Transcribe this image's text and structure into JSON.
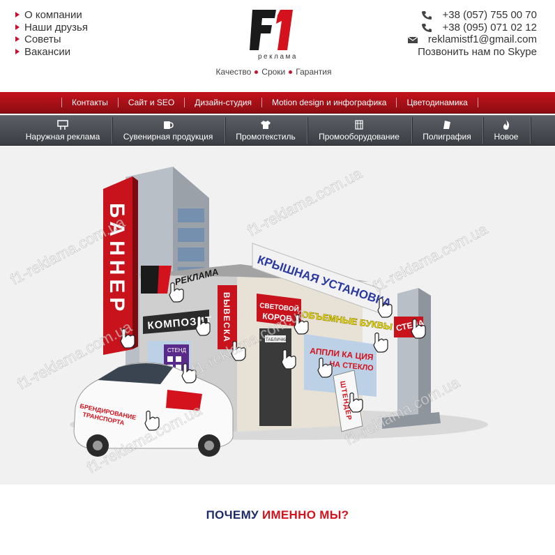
{
  "header": {
    "left_links": [
      "О компании",
      "Наши друзья",
      "Советы",
      "Вакансии"
    ],
    "logo_text": "реклама",
    "tagline": [
      "Качество",
      "Сроки",
      "Гарантия"
    ],
    "phones": [
      "+38 (057) 755 00 70",
      "+38 (095) 071 02 12"
    ],
    "email": "reklamistf1@gmail.com",
    "skype": "Позвонить нам по Skype"
  },
  "nav_red": [
    "Контакты",
    "Сайт и SEO",
    "Дизайн-студия",
    "Motion design и инфографика",
    "Цветодинамика"
  ],
  "nav_dark": [
    {
      "label": "Наружная реклама",
      "icon": "billboard-icon"
    },
    {
      "label": "Сувенирная продукция",
      "icon": "mug-icon"
    },
    {
      "label": "Промотекстиль",
      "icon": "tshirt-icon"
    },
    {
      "label": "Промооборудование",
      "icon": "stand-icon"
    },
    {
      "label": "Полиграфия",
      "icon": "paper-icon"
    },
    {
      "label": "Новое",
      "icon": "fire-icon"
    }
  ],
  "hero": {
    "banner": "БАННЕР",
    "brand": "РЕКЛАМА",
    "roof_sign": "КРЫШНАЯ УСТАНОВКА",
    "composite": "КОМПОЗИТ",
    "vyveska": "ВЫВЕСКА",
    "lightbox": [
      "СВЕТОВОЙ",
      "КОРОБ"
    ],
    "letters": "ОБЪЕМНЫЕ БУКВЫ",
    "application": [
      "АППЛИ КА ЦИЯ",
      "НА СТЕКЛО"
    ],
    "stand": "СТЕНД",
    "plate": "ТАБЛИЧКИ",
    "stela": "СТЕЛА",
    "shtender": "ШТЕНДЕР",
    "car": [
      "БРЕНДИРОВАНИЕ",
      "ТРАНСПОРТА"
    ],
    "watermark": "f1-reklama.com.ua"
  },
  "why": {
    "part1": "ПОЧЕМУ",
    "part2": "ИМЕННО МЫ?"
  },
  "colors": {
    "accent_red": "#c8102e",
    "dark_nav": "#3a3d42",
    "title_blue": "#1c2a6b"
  }
}
